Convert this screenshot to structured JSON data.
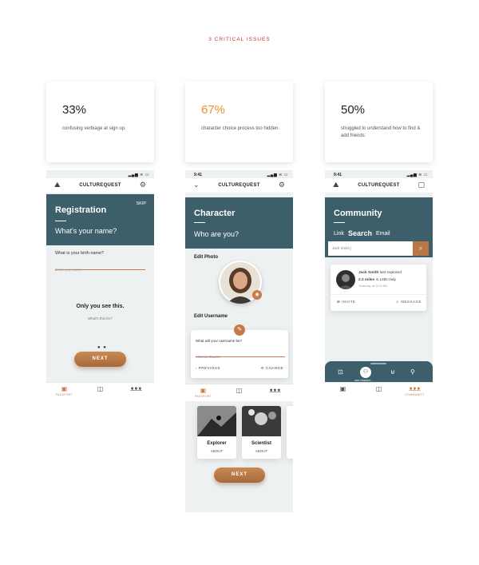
{
  "header": {
    "title": "3 CRITICAL ISSUES"
  },
  "stats": [
    {
      "percent": "33%",
      "desc": "confusing verbiage at sign up.",
      "color": "#222222"
    },
    {
      "percent": "67%",
      "desc": "character choice process too hidden.",
      "color": "#f0902a"
    },
    {
      "percent": "50%",
      "desc": "struggled to understand how to find & add friends.",
      "color": "#222222"
    }
  ],
  "brand": "CULTUREQUEST",
  "time": "9:41",
  "registration": {
    "skip": "SKIP",
    "title": "Registration",
    "subtitle": "What's your name?",
    "field_label": "What is your birth name?",
    "field_placeholder": "Enter your name",
    "only_you": "Only you see this.",
    "whats_this": "What's this for?",
    "next": "NEXT",
    "tab_passport": "PASSPORT"
  },
  "character": {
    "title": "Character",
    "subtitle": "Who are you?",
    "edit_photo": "Edit Photo",
    "edit_username": "Edit Username",
    "username_question": "What will your username be?",
    "username_value": "Artemis Owens",
    "previous": "PREVIOUS",
    "change": "CHANGE",
    "tab_passport": "PASSPORT",
    "roles": [
      {
        "name": "Explorer",
        "about": "ABOUT"
      },
      {
        "name": "Scientist",
        "about": "ABOUT"
      }
    ],
    "next": "NEXT"
  },
  "community": {
    "title": "Community",
    "tabs": [
      "Link",
      "Search",
      "Email"
    ],
    "search_value": "Jack Smith |",
    "friend_name": "Jack Smith",
    "friend_action": "last explored",
    "friend_distance": "2.2 miles",
    "friend_place": "in Little Italy",
    "friend_time": "Yesterday, at 12:47 AM",
    "invite": "INVITE",
    "message": "MESSAGE",
    "add_friends": "ADD FRIENDS",
    "tab_community": "COMMUNITY"
  }
}
